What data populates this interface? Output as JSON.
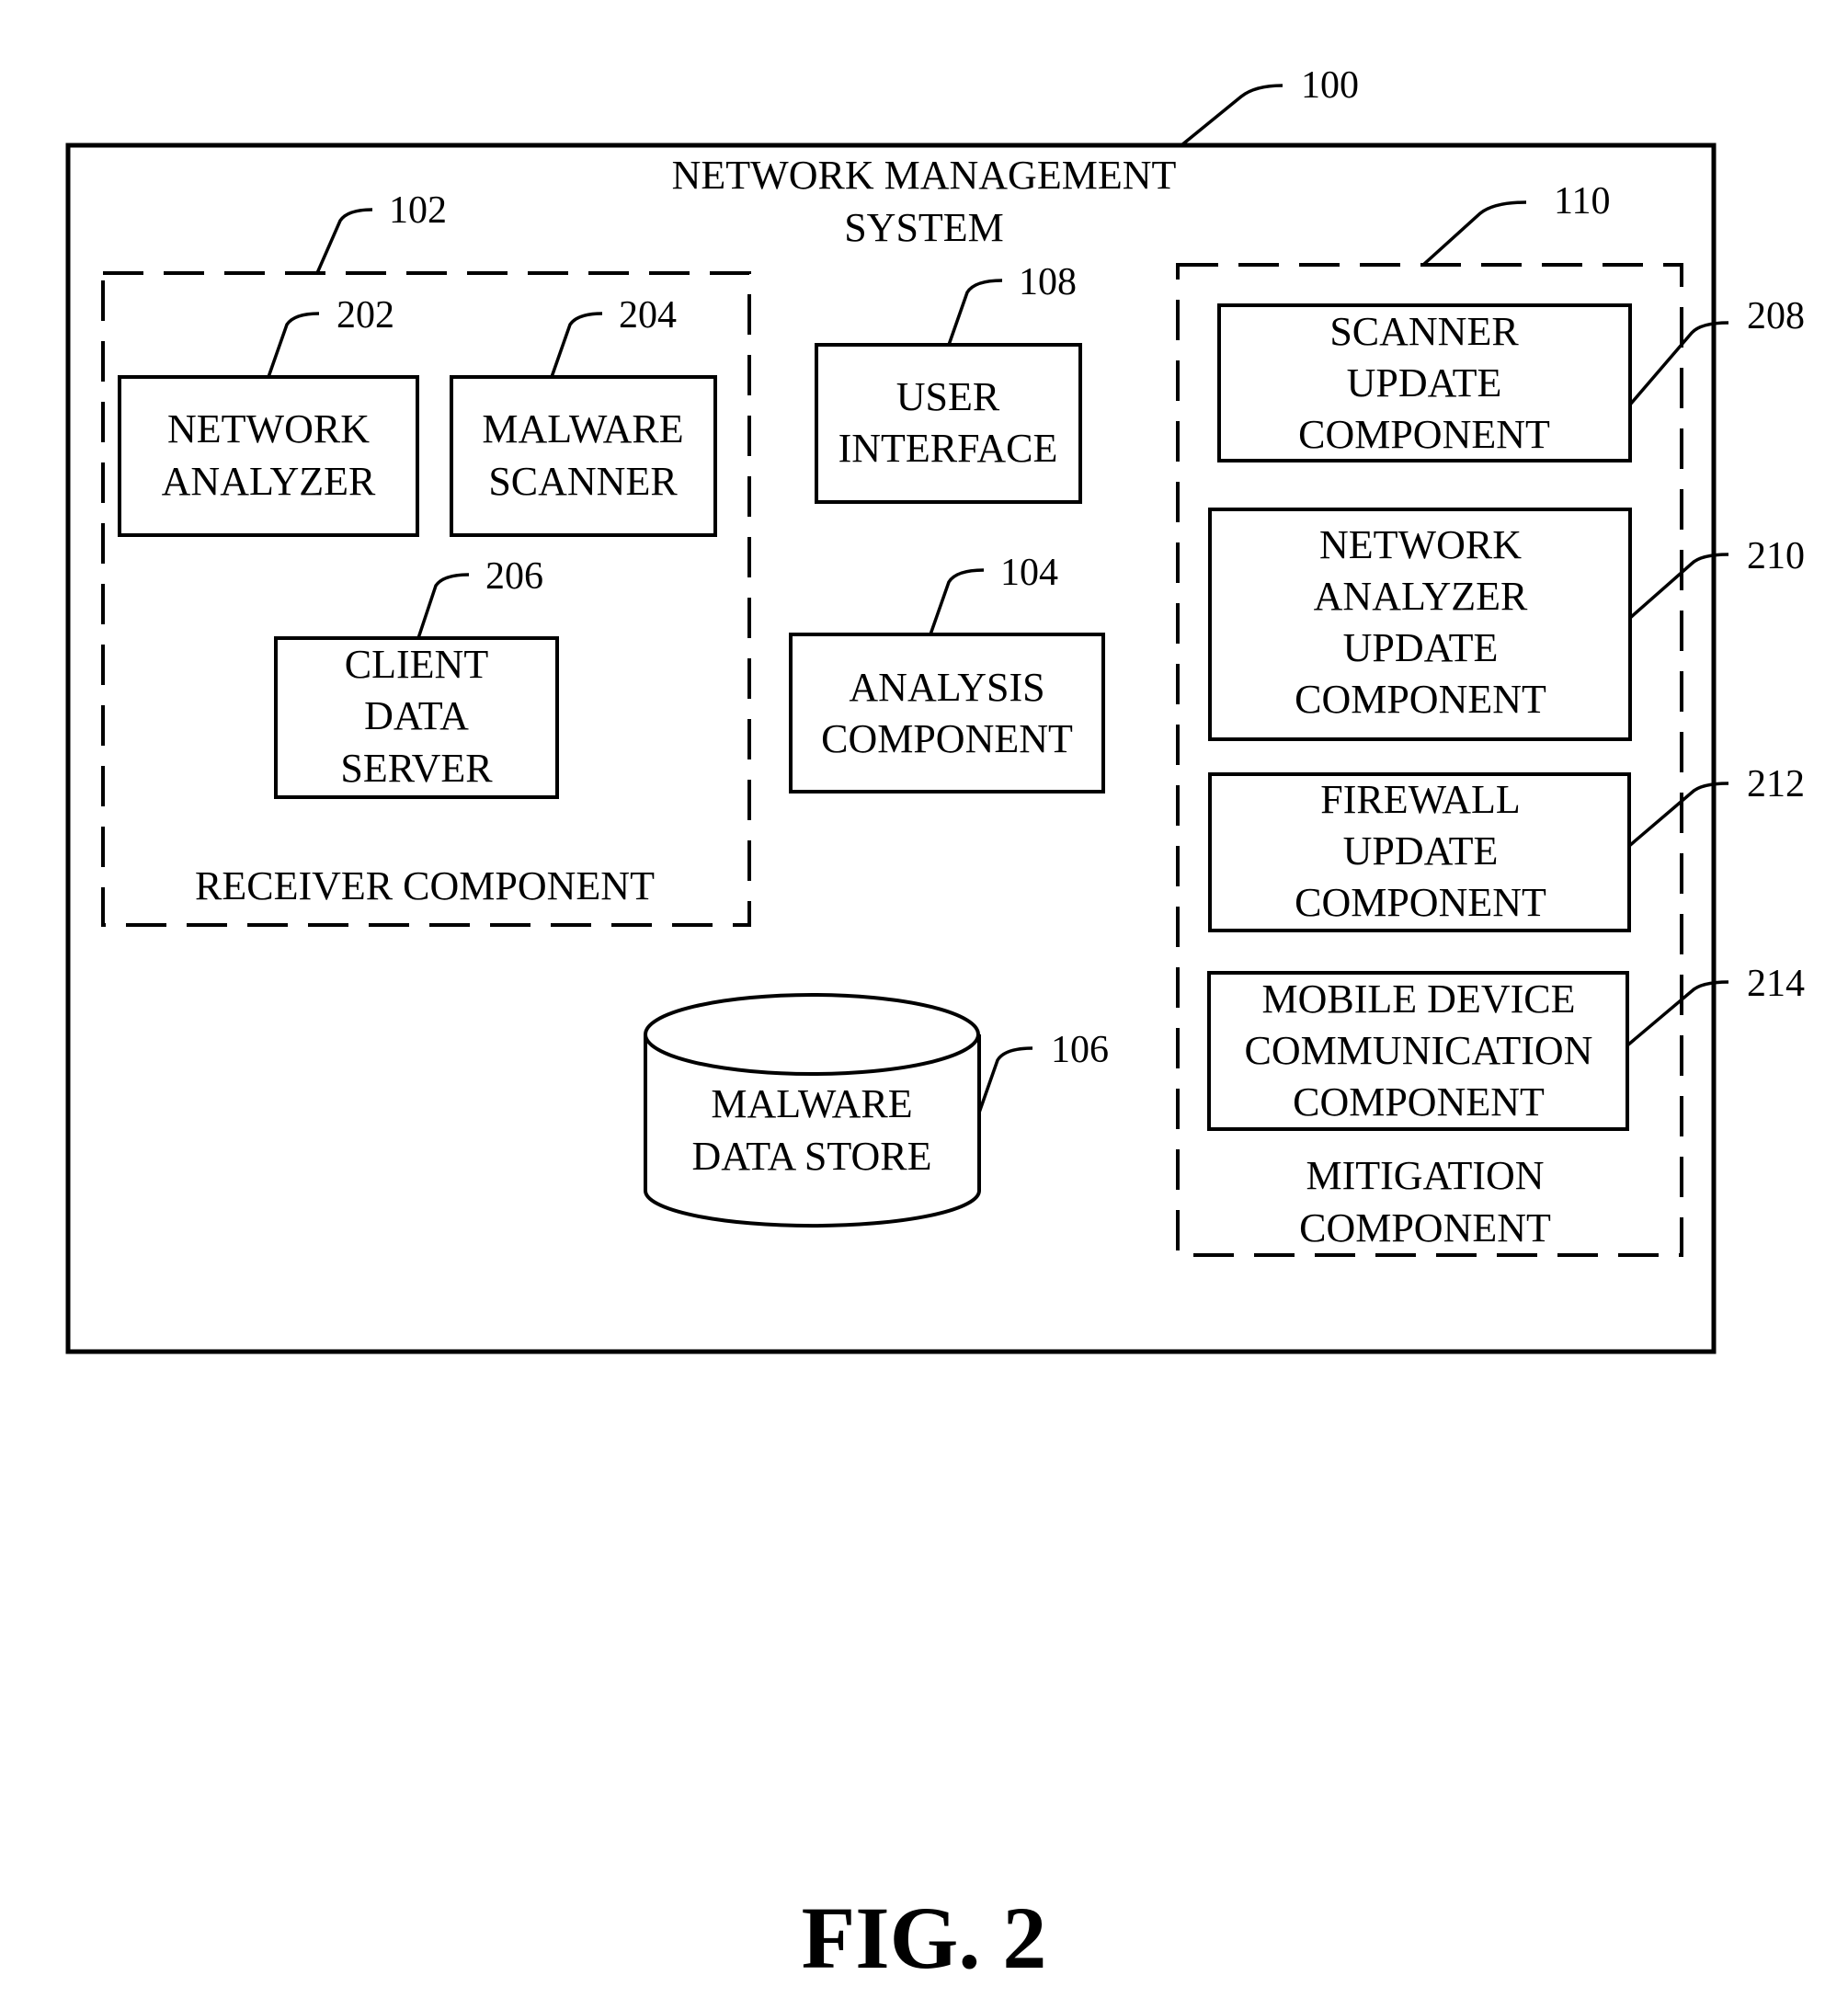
{
  "figure_label": "FIG. 2",
  "system": {
    "ref": "100",
    "title_lines": [
      "NETWORK MANAGEMENT",
      "SYSTEM"
    ]
  },
  "receiver": {
    "ref": "102",
    "label": "RECEIVER COMPONENT",
    "components": [
      {
        "ref": "202",
        "lines": [
          "NETWORK",
          "ANALYZER"
        ]
      },
      {
        "ref": "204",
        "lines": [
          "MALWARE",
          "SCANNER"
        ]
      },
      {
        "ref": "206",
        "lines": [
          "CLIENT",
          "DATA",
          "SERVER"
        ]
      }
    ]
  },
  "user_interface": {
    "ref": "108",
    "lines": [
      "USER",
      "INTERFACE"
    ]
  },
  "analysis": {
    "ref": "104",
    "lines": [
      "ANALYSIS",
      "COMPONENT"
    ]
  },
  "data_store": {
    "ref": "106",
    "lines": [
      "MALWARE",
      "DATA STORE"
    ]
  },
  "mitigation": {
    "ref": "110",
    "label_lines": [
      "MITIGATION",
      "COMPONENT"
    ],
    "components": [
      {
        "ref": "208",
        "lines": [
          "SCANNER",
          "UPDATE",
          "COMPONENT"
        ]
      },
      {
        "ref": "210",
        "lines": [
          "NETWORK",
          "ANALYZER",
          "UPDATE",
          "COMPONENT"
        ]
      },
      {
        "ref": "212",
        "lines": [
          "FIREWALL",
          "UPDATE",
          "COMPONENT"
        ]
      },
      {
        "ref": "214",
        "lines": [
          "MOBILE DEVICE",
          "COMMUNICATION",
          "COMPONENT"
        ]
      }
    ]
  }
}
